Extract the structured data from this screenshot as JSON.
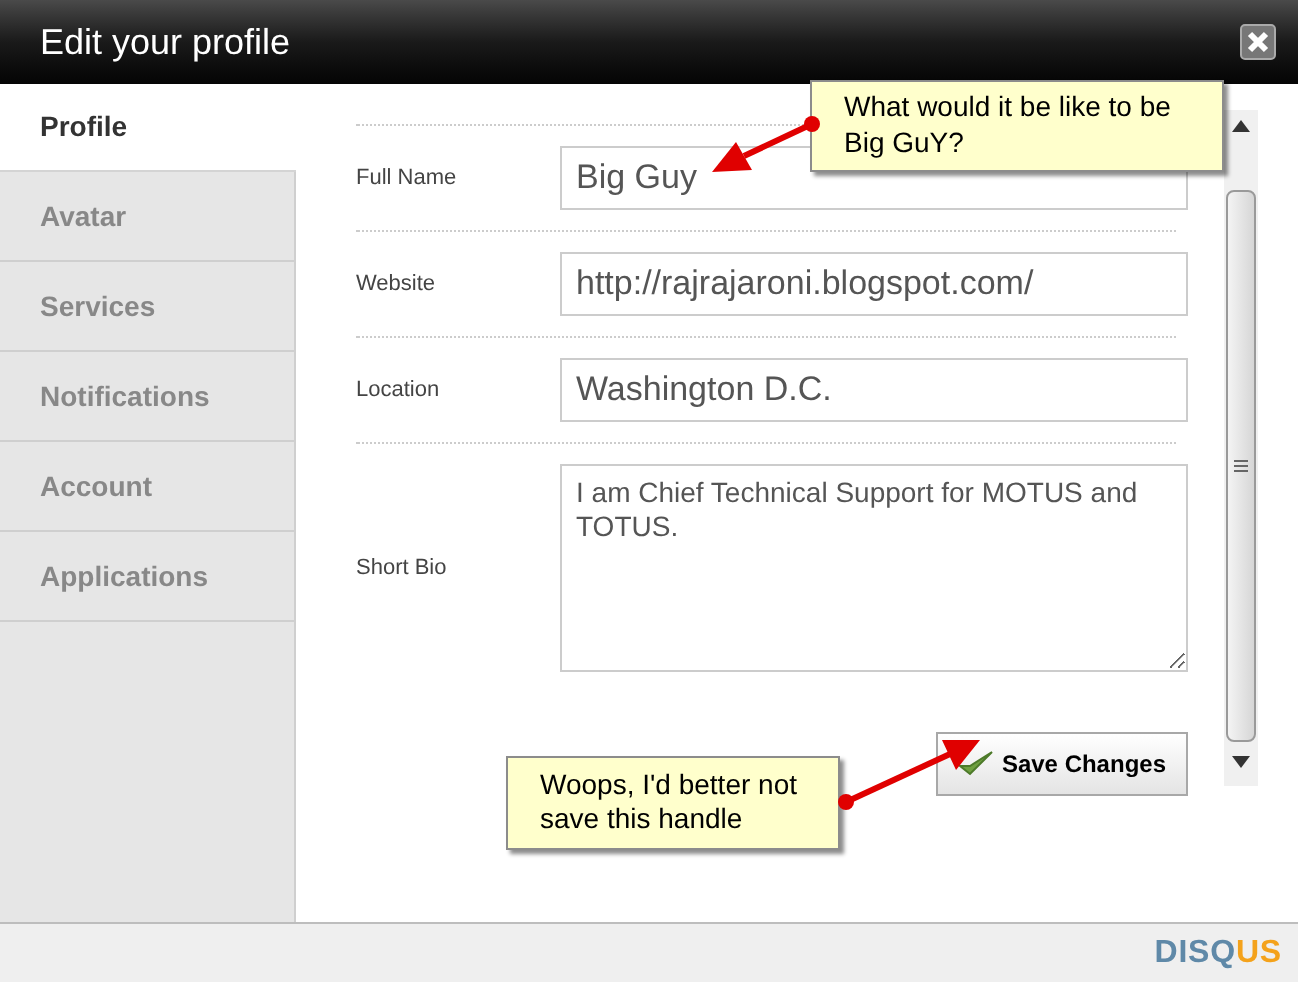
{
  "window": {
    "title": "Edit your profile"
  },
  "sidebar": {
    "items": [
      {
        "label": "Profile",
        "selected": true
      },
      {
        "label": "Avatar",
        "selected": false
      },
      {
        "label": "Services",
        "selected": false
      },
      {
        "label": "Notifications",
        "selected": false
      },
      {
        "label": "Account",
        "selected": false
      },
      {
        "label": "Applications",
        "selected": false
      }
    ]
  },
  "form": {
    "fields": [
      {
        "label": "Full Name",
        "value": "Big Guy",
        "kind": "text"
      },
      {
        "label": "Website",
        "value": "http://rajrajaroni.blogspot.com/",
        "kind": "text"
      },
      {
        "label": "Location",
        "value": "Washington D.C.",
        "kind": "text"
      },
      {
        "label": "Short Bio",
        "value": "I am Chief Technical Support for MOTUS and TOTUS.",
        "kind": "textarea"
      }
    ],
    "save_button": "Save Changes"
  },
  "callouts": [
    {
      "text": "What would it be like to be Big GuY?"
    },
    {
      "text": "Woops, I'd better not save this handle"
    }
  ],
  "footer": {
    "logo": "DISQ",
    "logo_accent": "US"
  }
}
